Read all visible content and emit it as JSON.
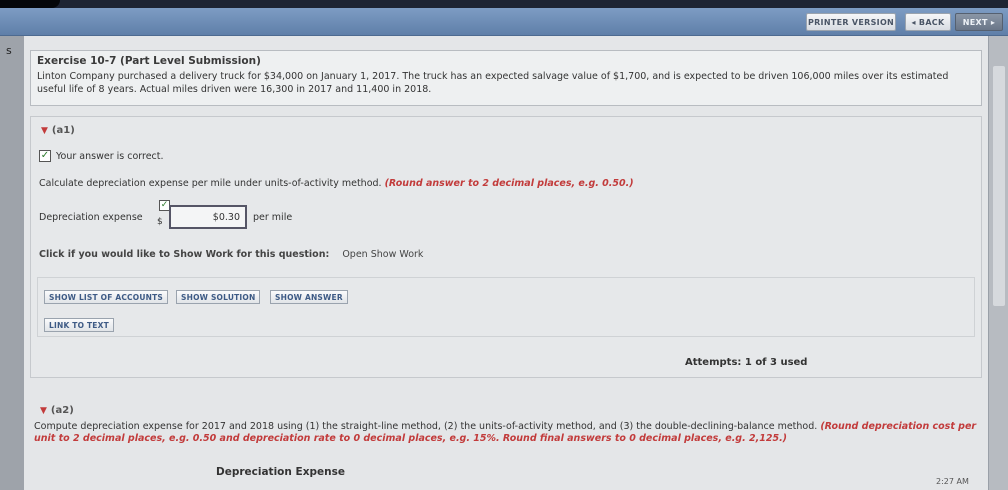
{
  "nav": {
    "print_label": "PRINTER VERSION",
    "back_label": "◂ BACK",
    "next_label": "NEXT ▸"
  },
  "left_edge_char": "s",
  "exercise": {
    "title": "Exercise 10-7 (Part Level Submission)",
    "body": "Linton Company purchased a delivery truck for $34,000 on January 1, 2017. The truck has an expected salvage value of $1,700, and is expected to be driven 106,000 miles over its estimated useful life of 8 years. Actual miles driven were 16,300 in 2017 and 11,400 in 2018."
  },
  "part_a1": {
    "label": "(a1)",
    "correct_text": "Your answer is correct.",
    "instruction": "Calculate depreciation expense per mile under units-of-activity method.",
    "instruction_hint": "(Round answer to 2 decimal places, e.g. 0.50.)",
    "dep_label": "Depreciation expense",
    "dollar": "$",
    "dep_value": "$0.30",
    "unit": "per mile",
    "show_work_prompt": "Click if you would like to Show Work for this question:",
    "show_work_link": "Open Show Work",
    "buttons": {
      "list_accounts": "SHOW LIST OF ACCOUNTS",
      "solution": "SHOW SOLUTION",
      "answer": "SHOW ANSWER",
      "link_text": "LINK TO TEXT"
    },
    "attempts": "Attempts: 1 of 3 used"
  },
  "part_a2": {
    "label": "(a2)",
    "text": "Compute depreciation expense for 2017 and 2018 using (1) the straight-line method, (2) the units-of-activity method, and (3) the double-declining-balance method.",
    "hint": "(Round depreciation cost per unit to 2 decimal places, e.g. 0.50 and depreciation rate to 0 decimal places, e.g. 15%. Round final answers to 0 decimal places, e.g. 2,125.)",
    "section_title": "Depreciation Expense"
  },
  "time": "2:27 AM",
  "colors": {
    "hint_red": "#c23b3b",
    "nav_blue": "#6a88b2"
  }
}
